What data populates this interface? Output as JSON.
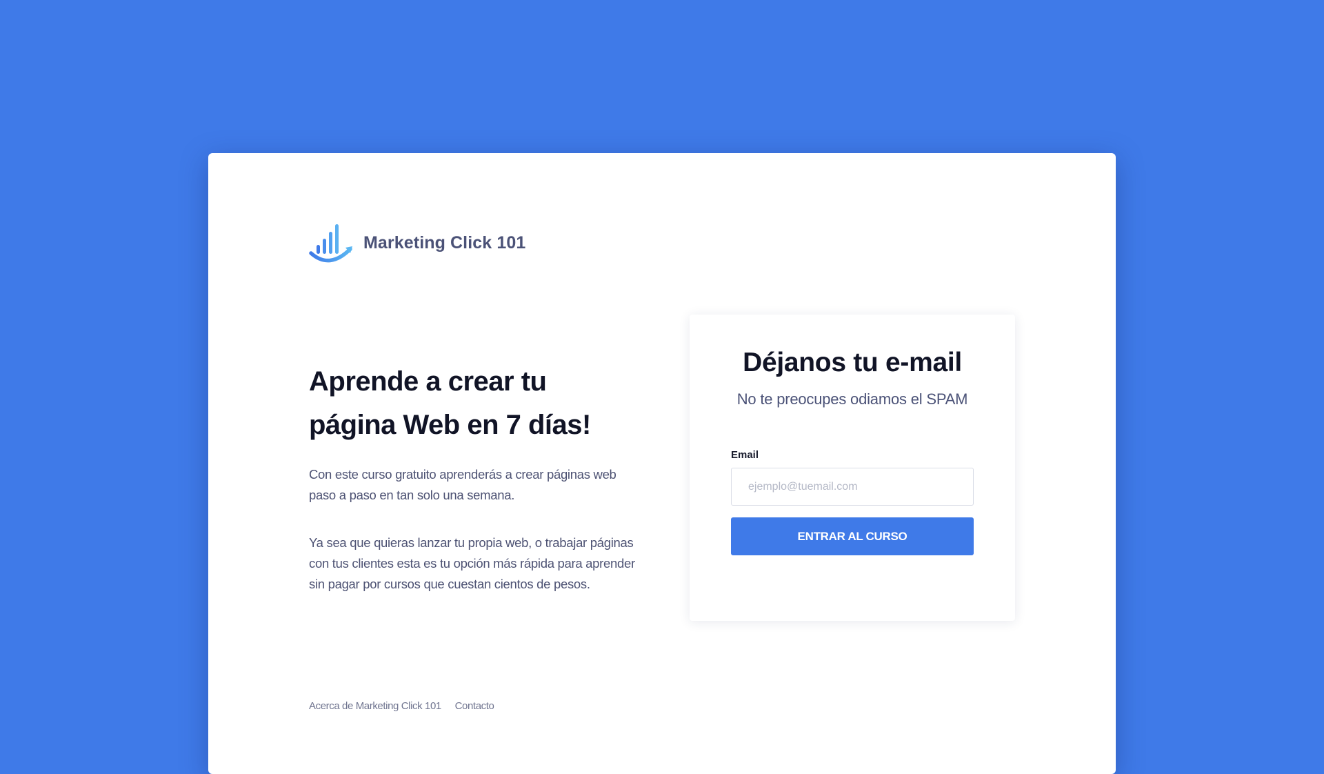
{
  "brand": {
    "name": "Marketing Click 101",
    "logo_icon": "bar-chart-smile-icon",
    "logo_colors": [
      "#3f7ae8",
      "#5aaef0"
    ]
  },
  "hero": {
    "title_line1": "Aprende a crear tu",
    "title_line2": "página Web en 7 días!",
    "paragraph1": "Con este curso gratuito aprenderás a crear páginas web paso a paso en tan solo una semana.",
    "paragraph2": "Ya sea que quieras lanzar tu propia web, o trabajar páginas con tus clientes esta es tu opción más rápida para aprender sin pagar por cursos que cuestan cientos de pesos."
  },
  "optin": {
    "title": "Déjanos tu e-mail",
    "subtitle": "No te preocupes odiamos el SPAM",
    "email_label": "Email",
    "email_placeholder": "ejemplo@tuemail.com",
    "email_value": "",
    "submit_label": "ENTRAR AL CURSO"
  },
  "footer": {
    "links": [
      "Acerca de Marketing Click 101",
      "Contacto"
    ]
  },
  "colors": {
    "background": "#3f7ae8",
    "accent": "#3f7ae8",
    "heading": "#111426",
    "body_text": "#4d5273"
  }
}
